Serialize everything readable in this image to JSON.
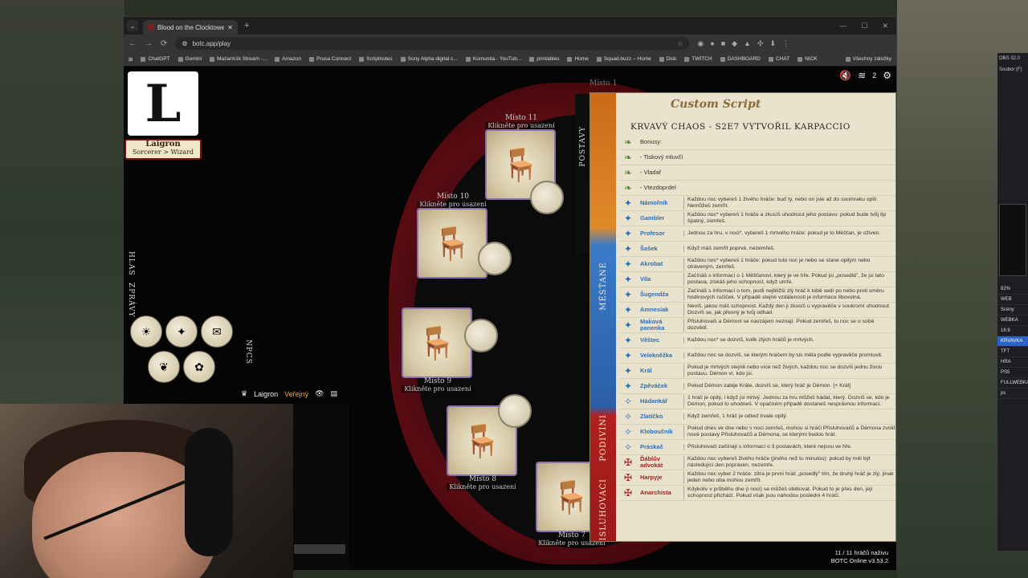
{
  "browser": {
    "tab_title": "Blood on the Clocktower Online",
    "new_tab": "+",
    "url": "botc.app/play",
    "window_controls": [
      "—",
      "☐",
      "✕"
    ],
    "bookmarks": [
      "ChatGPT",
      "Gemini",
      "Mazarin1k Stream -...",
      "Amazon",
      "Prusa Connect",
      "Scriptnotes",
      "Sony Alpha digital c...",
      "Komunita - YouTub...",
      "printables",
      "Home",
      "Squad.buzz – Home",
      "Disk",
      "TWITCH",
      "DASHBOARD",
      "CHAT",
      "NICK"
    ],
    "all_bookmarks": "Všechny záložky"
  },
  "player": {
    "token_letter": "L",
    "name": "Laigron",
    "role": "Sorcerer > Wizard"
  },
  "seats": [
    {
      "label": "Místo 11",
      "hint": "Klikněte pro usazení"
    },
    {
      "label": "Místo 10",
      "hint": "Klikněte pro usazení"
    },
    {
      "label": "Místo 9",
      "hint": "Klikněte pro usazení"
    },
    {
      "label": "Místo 8",
      "hint": "Klikněte pro usazení"
    },
    {
      "label": "Místo 7",
      "hint": "Klikněte pro usazení"
    }
  ],
  "misto1": "Místo 1",
  "postavy": "POSTAVY",
  "left_panel": {
    "hlas": "HLAS",
    "zpravy": "ZPRÁVY",
    "npcs": "NPCS"
  },
  "userbar": {
    "user": "Laigron",
    "visibility": "Veřejný"
  },
  "topbar": {
    "players_count": "2"
  },
  "status": {
    "players": "11 / 11 hráčů naživu",
    "version": "BOTC Online v3.53.2"
  },
  "script": {
    "banner": "Custom Script",
    "title": "KRVAVÝ CHAOS - S2E7 VYTVOŘIL KARPACCIO",
    "sections": {
      "townsfolk": "MĚŠŤANÉ",
      "outsiders": "PODIVÍNI",
      "minions": "PŘISLUHOVAČI"
    },
    "bonus": [
      {
        "name": "Bonusy:"
      },
      {
        "name": "- Tiskový mluvčí"
      },
      {
        "name": "- Vladař"
      },
      {
        "name": "- Vtezdoprdel"
      }
    ],
    "townsfolk": [
      {
        "name": "Námořník",
        "desc": "Každou noc vybereš 1 živého hráče: buď ty, nebo on jste až do soumraku opilí. Nemůžeš zemřít."
      },
      {
        "name": "Gambler",
        "desc": "Každou noc* vybereš 1 hráče a zkusíš uhodnout jeho postavu: pokud bude tvůj tip špatný, zemřeš."
      },
      {
        "name": "Profesor",
        "desc": "Jednou za hru, v noci*, vybereš 1 mrtvého hráče: pokud je to Měšťan, je oživen."
      },
      {
        "name": "Šašek",
        "desc": "Když máš zemřít poprvé, nezemřeš."
      },
      {
        "name": "Akrobat",
        "desc": "Každou noc* vybereš 1 hráče: pokud tuto noc je nebo se stane opilým nebo otráveným, zemřeš."
      },
      {
        "name": "Víla",
        "desc": "Začínáš s informací o 1 Měšťanovi, který je ve hře. Pokud jsi „posedlá\", že jsi tato postava, získáš jeho schopnost, když umře."
      },
      {
        "name": "Šugendža",
        "desc": "Začínáš s informací o tom, jestli nejbližší zlý hráč k tobě sedí po nebo proti směru hodinových ručiček. V případě stejné vzdálenosti je informace libovolná."
      },
      {
        "name": "Amnesiak",
        "desc": "Nevíš, jakou máš schopnost. Každý den ji zkusíš u vypravěče v soukromí uhodnout. Dozvíš se, jak přesný je tvůj odhad."
      },
      {
        "name": "Maková panenka",
        "desc": "Přisluhovači a Démoni se navzájem neznají. Pokud zemřeš, tu noc se o sobě dozvědí."
      },
      {
        "name": "Věštec",
        "desc": "Každou noc* se dozvíš, kolik zlých hráčů je mrtvých."
      },
      {
        "name": "Velekněžka",
        "desc": "Každou noc se dozvíš, se kterým hráčem by sis měla podle vypravěče promluvit."
      },
      {
        "name": "Král",
        "desc": "Pokud je mrtvých stejně nebo více než živých, každou noc se dozvíš jednu živou postavu. Démon ví, kdo jsi."
      },
      {
        "name": "Zpěváček",
        "desc": "Pokud Démon zabije Krále, dozvíš se, který hráč je Démon. [+ Král]"
      }
    ],
    "outsiders": [
      {
        "name": "Hádankář",
        "desc": "1 hráč je opilý, i když jsi mrtvý. Jednou za hru můžeš hádat, který. Dozvíš se, kdo je Démon, pokud to uhodneš. V opačném případě dostaneš nesprávnou informaci."
      },
      {
        "name": "Zlatíčko",
        "desc": "Když zemřeš, 1 hráč je odteď trvale opilý."
      },
      {
        "name": "Kloboučník",
        "desc": "Pokud dnes ve dne nebo v noci zemřeš, mohou si hráči Přisluhovačů a Démona zvolit nové postavy Přisluhovačů a Démona, se kterými budou hrát."
      },
      {
        "name": "Práskač",
        "desc": "Přisluhovači začínají s informací o 3 postavách, které nejsou ve hře."
      }
    ],
    "minions": [
      {
        "name": "Ďáblův advokát",
        "desc": "Každou noc vybereš živého hráče (jiného než tu minulou): pokud by měl být následující den popraven, nezemře."
      },
      {
        "name": "Harpyje",
        "desc": "Každou noc vyber 2 hráče: zítra je první hráč „posedlý\" tím, že druhý hráč je zlý, jinak jeden nebo oba mohou zemřít."
      },
      {
        "name": "Anarchista",
        "desc": "Kdykoliv v průběhu dne (i noci) se můžeš obětovat. Pokud to je přes den, její schopnost přichází. Pokud však jsou náhodou posledni 4 hráči."
      }
    ]
  },
  "obs": {
    "title": "OBS 32.0",
    "menu": "Soubor (F)",
    "web": "WEB",
    "zoom": "82%",
    "scenes_label": "Scény",
    "scenes": [
      "WEBKA",
      "16:9",
      "KRVAVKA",
      "TFT",
      "HRA",
      "PS5",
      "FULLWEBKA",
      "ps"
    ],
    "active_scene": "KRVAVKA"
  }
}
